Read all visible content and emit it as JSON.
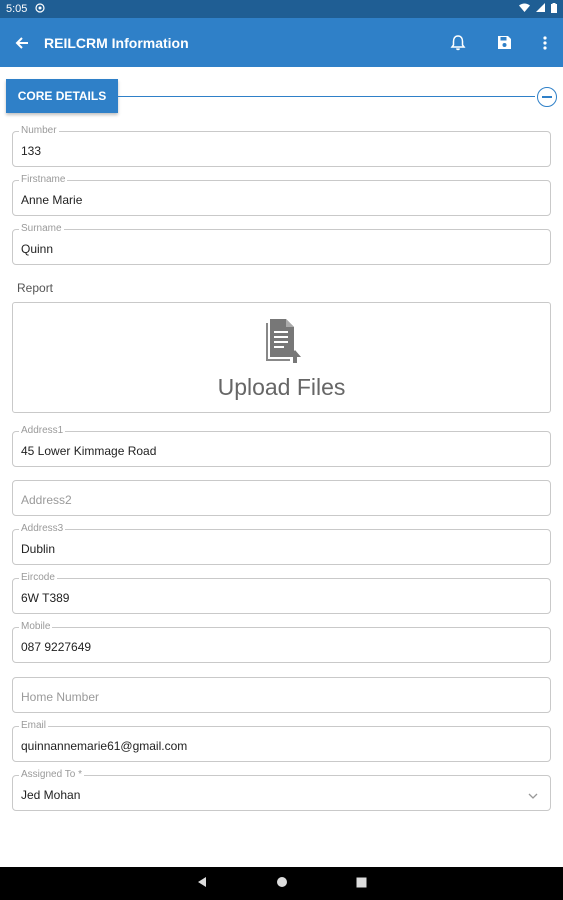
{
  "status_bar": {
    "time": "5:05"
  },
  "app_bar": {
    "title": "REILCRM Information"
  },
  "section": {
    "title": "CORE DETAILS"
  },
  "fields": {
    "number": {
      "label": "Number",
      "value": "133"
    },
    "firstname": {
      "label": "Firstname",
      "value": "Anne Marie"
    },
    "surname": {
      "label": "Surname",
      "value": "Quinn"
    },
    "address1": {
      "label": "Address1",
      "value": "45 Lower Kimmage Road"
    },
    "address2": {
      "placeholder": "Address2"
    },
    "address3": {
      "label": "Address3",
      "value": "Dublin"
    },
    "eircode": {
      "label": "Eircode",
      "value": "6W T389"
    },
    "mobile": {
      "label": "Mobile",
      "value": "087 9227649"
    },
    "home_number": {
      "placeholder": "Home Number"
    },
    "email": {
      "label": "Email",
      "value": "quinnannemarie61@gmail.com"
    },
    "assigned_to": {
      "label": "Assigned To *",
      "value": "Jed Mohan"
    }
  },
  "report": {
    "label": "Report",
    "upload_text": "Upload Files"
  },
  "colors": {
    "primary": "#2f80c8",
    "status_bar": "#1f5e94"
  },
  "icons": [
    "back-arrow-icon",
    "bell-icon",
    "save-icon",
    "more-vert-icon",
    "upload-file-icon",
    "chevron-down-icon",
    "minus-circle-icon"
  ]
}
